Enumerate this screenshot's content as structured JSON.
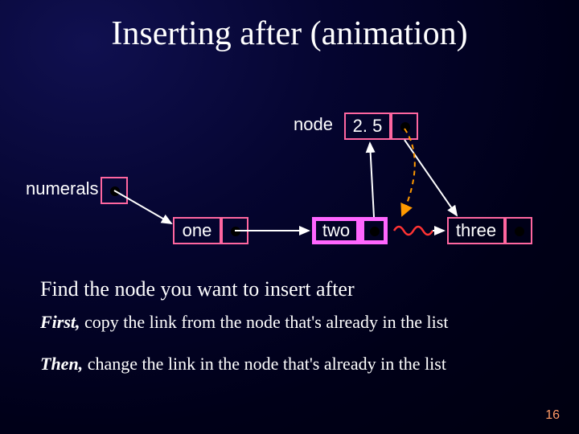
{
  "title": "Inserting after (animation)",
  "labels": {
    "node": "node",
    "numerals": "numerals"
  },
  "nodes": {
    "new_node": "2. 5",
    "one": "one",
    "two": "two",
    "three": "three"
  },
  "text": {
    "find": "Find the node you want to insert after",
    "first_label": "First,",
    "first_rest": " copy the link from the node that's already in the list",
    "then_label": "Then,",
    "then_rest": " change the link in the node that's already in the list"
  },
  "page_number": "16"
}
